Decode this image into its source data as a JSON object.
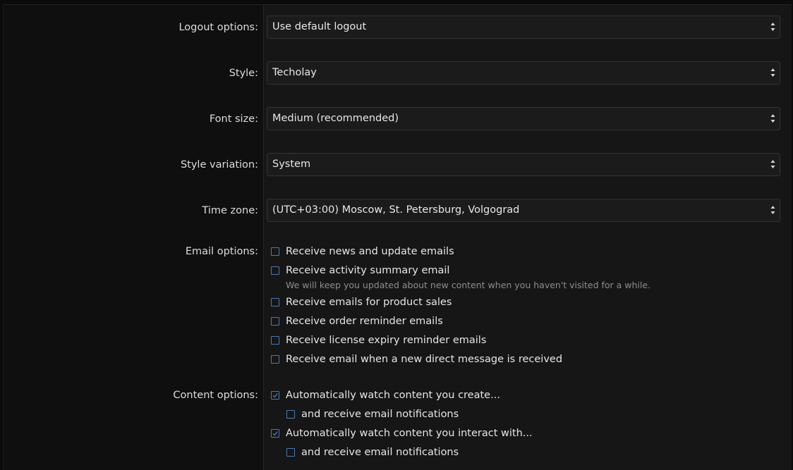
{
  "preferences": {
    "logout": {
      "label": "Logout options:",
      "value": "Use default logout"
    },
    "style": {
      "label": "Style:",
      "value": "Techolay"
    },
    "font_size": {
      "label": "Font size:",
      "value": "Medium (recommended)"
    },
    "style_variation": {
      "label": "Style variation:",
      "value": "System"
    },
    "time_zone": {
      "label": "Time zone:",
      "value": "(UTC+03:00) Moscow, St. Petersburg, Volgograd"
    }
  },
  "email_options": {
    "label": "Email options:",
    "items": [
      {
        "text": "Receive news and update emails",
        "checked": false
      },
      {
        "text": "Receive activity summary email",
        "checked": false,
        "hint": "We will keep you updated about new content when you haven't visited for a while."
      },
      {
        "text": "Receive emails for product sales",
        "checked": false
      },
      {
        "text": "Receive order reminder emails",
        "checked": false
      },
      {
        "text": "Receive license expiry reminder emails",
        "checked": false
      },
      {
        "text": "Receive email when a new direct message is received",
        "checked": false
      }
    ]
  },
  "content_options": {
    "label": "Content options:",
    "items": [
      {
        "text": "Automatically watch content you create...",
        "checked": true
      },
      {
        "text": "and receive email notifications",
        "checked": false
      },
      {
        "text": "Automatically watch content you interact with...",
        "checked": true
      },
      {
        "text": "and receive email notifications",
        "checked": false
      }
    ]
  },
  "colors": {
    "accent": "#4a7ab3",
    "background": "#131313",
    "text": "#e6e6e6"
  }
}
